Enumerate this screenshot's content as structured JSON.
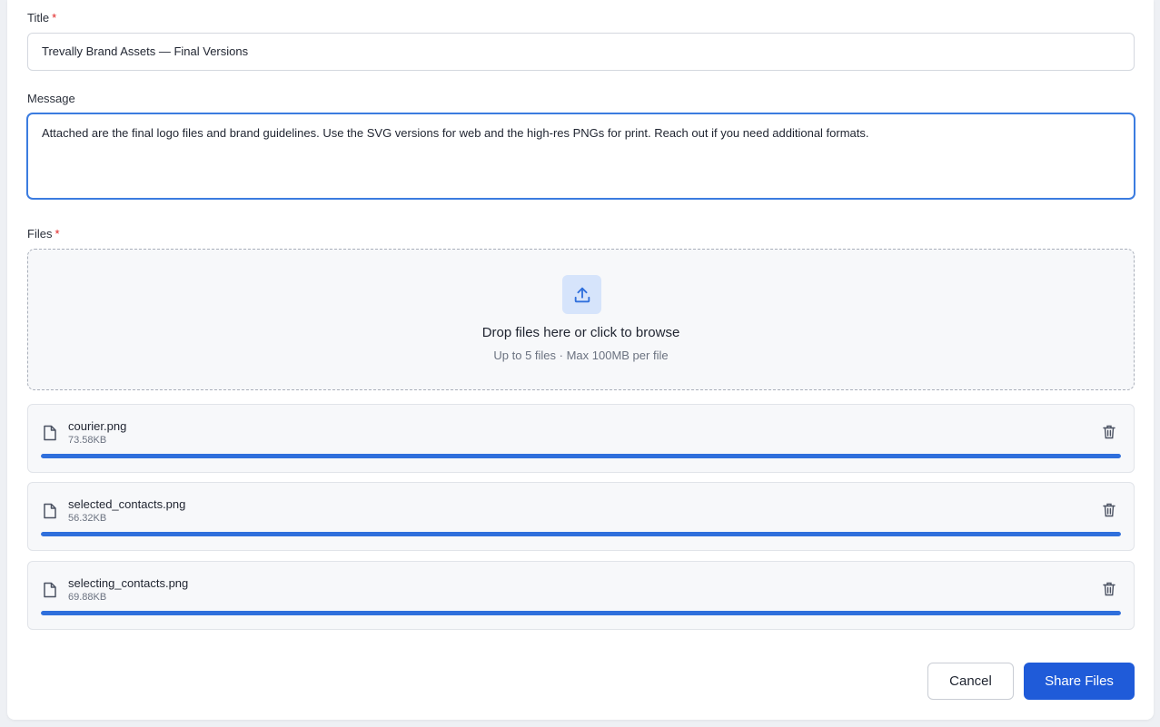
{
  "form": {
    "title_label": "Title",
    "required_mark": "*",
    "title_value": "Trevally Brand Assets — Final Versions",
    "message_label": "Message",
    "message_value": "Attached are the final logo files and brand guidelines. Use the SVG versions for web and the high-res PNGs for print. Reach out if you need additional formats.",
    "files_label": "Files"
  },
  "dropzone": {
    "title": "Drop files here or click to browse",
    "subtitle": "Up to 5 files · Max 100MB per file",
    "icon": "upload-icon"
  },
  "files": [
    {
      "name": "courier.png",
      "size": "73.58KB",
      "progress_percent": 100,
      "icon": "file-icon",
      "action_icon": "trash-icon"
    },
    {
      "name": "selected_contacts.png",
      "size": "56.32KB",
      "progress_percent": 100,
      "icon": "file-icon",
      "action_icon": "trash-icon"
    },
    {
      "name": "selecting_contacts.png",
      "size": "69.88KB",
      "progress_percent": 100,
      "icon": "file-icon",
      "action_icon": "trash-icon"
    }
  ],
  "actions": {
    "cancel_label": "Cancel",
    "share_label": "Share Files"
  },
  "colors": {
    "accent": "#1f5bd9",
    "progress": "#2f6fdc",
    "required": "#e02424",
    "focus_border": "#3b7ce0"
  }
}
